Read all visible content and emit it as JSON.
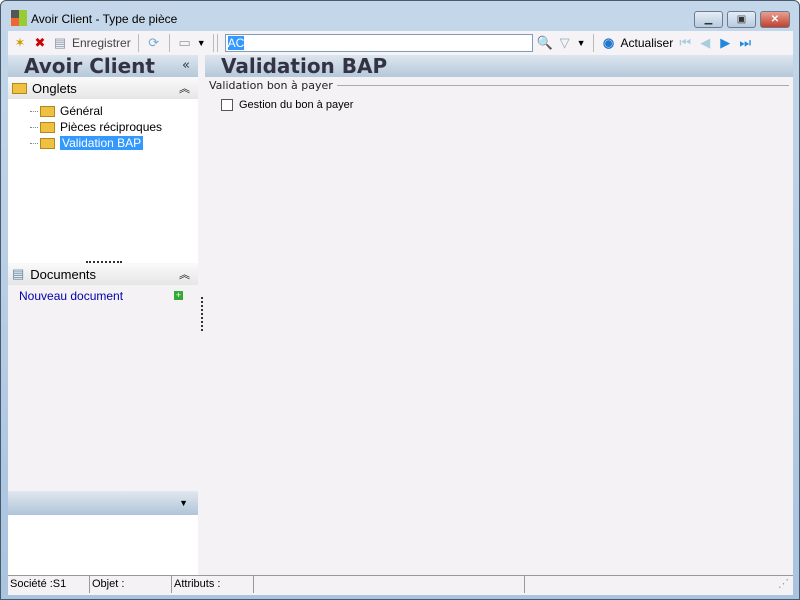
{
  "window": {
    "title": "Avoir Client -  Type de pièce"
  },
  "toolbar": {
    "save_label": "Enregistrer",
    "search_value": "AC",
    "refresh_label": "Actualiser"
  },
  "left": {
    "title": "Avoir Client",
    "collapse": "«",
    "tabs_section": "Onglets",
    "tabs": [
      {
        "label": "Général"
      },
      {
        "label": "Pièces réciproques"
      },
      {
        "label": "Validation BAP"
      }
    ],
    "documents_section": "Documents",
    "new_document": "Nouveau document"
  },
  "main": {
    "title": "Validation BAP",
    "group": "Validation bon à payer",
    "checkbox": "Gestion du bon à payer"
  },
  "status": {
    "societe": "Société :S1",
    "objet": "Objet :",
    "attributs": "Attributs :"
  }
}
